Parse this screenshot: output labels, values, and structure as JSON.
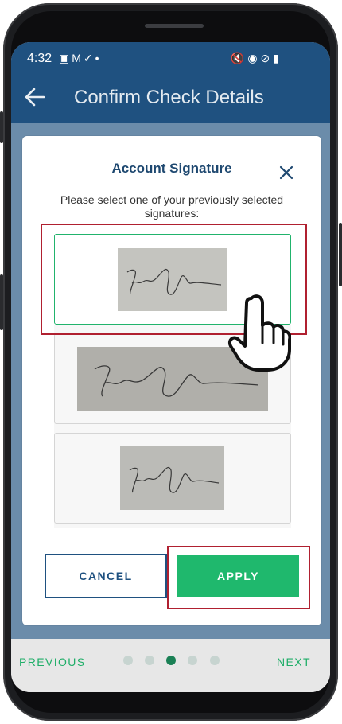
{
  "status_bar": {
    "time": "4:32",
    "icons_left": [
      "image-icon",
      "gmail-icon",
      "check-icon",
      "dot-icon"
    ],
    "icons_right": [
      "mute-icon",
      "wifi-icon",
      "no-disturb-icon",
      "battery-icon"
    ]
  },
  "header": {
    "title": "Confirm Check Details"
  },
  "modal": {
    "title": "Account Signature",
    "instruction": "Please select one of your previously selected signatures:",
    "signatures": [
      {
        "selected": true
      },
      {
        "selected": false
      },
      {
        "selected": false
      }
    ],
    "cancel_label": "CANCEL",
    "apply_label": "APPLY"
  },
  "footer": {
    "previous_label": "PREVIOUS",
    "next_label": "NEXT",
    "pages": 5,
    "current_page": 3
  },
  "colors": {
    "appbar": "#1f5180",
    "accent_green": "#1fb86d",
    "highlight_red": "#b02030"
  }
}
